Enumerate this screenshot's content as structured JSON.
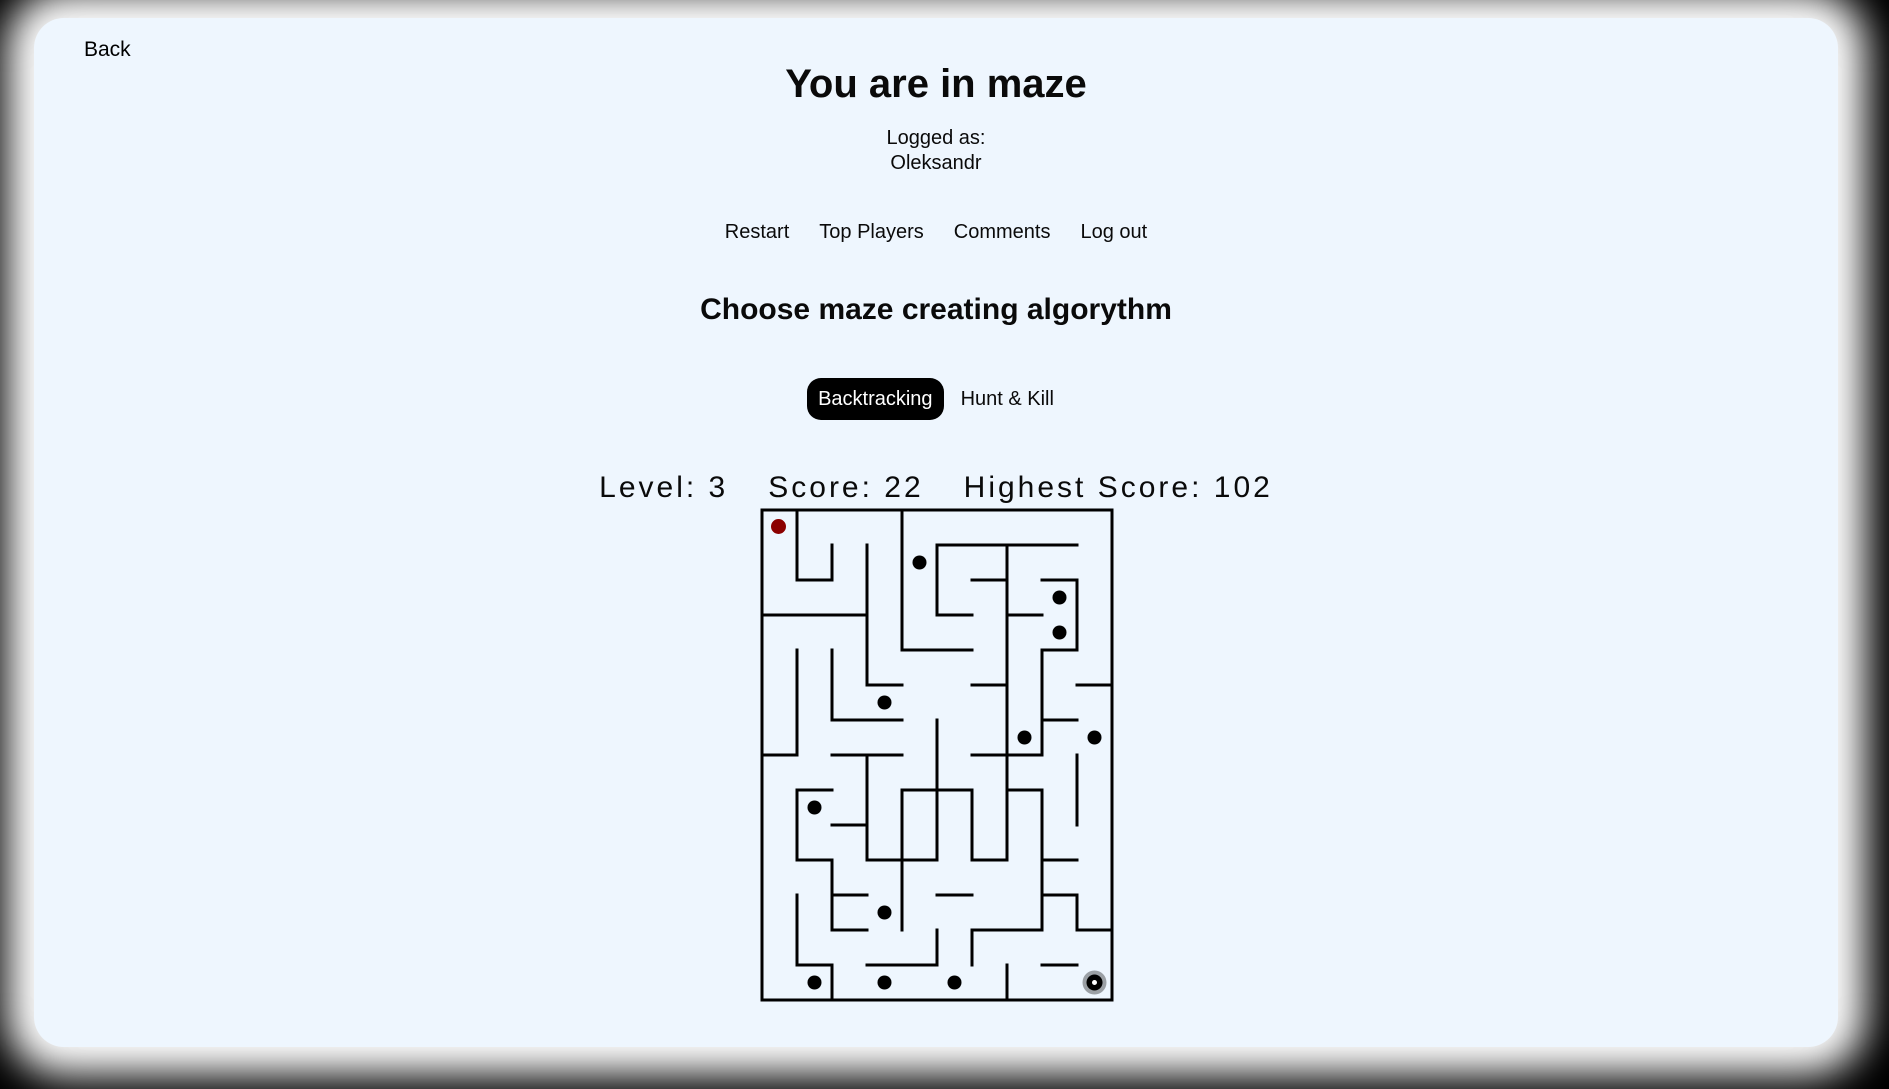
{
  "back_label": "Back",
  "title": "You are in maze",
  "logged_label": "Logged as:",
  "username": "Oleksandr",
  "nav": {
    "restart": "Restart",
    "top_players": "Top Players",
    "comments": "Comments",
    "logout": "Log out"
  },
  "algorithm_heading": "Choose maze creating algorythm",
  "algorithms": {
    "backtracking": "Backtracking",
    "hunt_kill": "Hunt & Kill",
    "selected": "Backtracking"
  },
  "stats": {
    "level": "Level: 3",
    "score": "Score: 22",
    "highest": "Highest Score: 102"
  },
  "maze": {
    "cols": 10,
    "rows": 14,
    "player_color": "#8b0000",
    "coin_color": "#000000",
    "player": [
      0,
      0
    ],
    "exit": [
      9,
      13
    ],
    "coins": [
      [
        4,
        1
      ],
      [
        8,
        2
      ],
      [
        8,
        3
      ],
      [
        3,
        5
      ],
      [
        7,
        6
      ],
      [
        9,
        6
      ],
      [
        1,
        8
      ],
      [
        3,
        11
      ],
      [
        1,
        13
      ],
      [
        3,
        13
      ],
      [
        5,
        13
      ]
    ],
    "walls": [
      [
        1,
        0,
        1,
        2
      ],
      [
        1,
        2,
        2,
        2
      ],
      [
        2,
        1,
        2,
        2
      ],
      [
        4,
        0,
        4,
        4
      ],
      [
        4,
        4,
        6,
        4
      ],
      [
        3,
        1,
        3,
        5
      ],
      [
        3,
        5,
        4,
        5
      ],
      [
        5,
        1,
        9,
        1
      ],
      [
        5,
        1,
        5,
        3
      ],
      [
        5,
        3,
        6,
        3
      ],
      [
        6,
        2,
        7,
        2
      ],
      [
        7,
        1,
        7,
        10
      ],
      [
        7,
        3,
        8,
        3
      ],
      [
        8,
        2,
        9,
        2
      ],
      [
        9,
        2,
        9,
        4
      ],
      [
        8,
        4,
        9,
        4
      ],
      [
        0,
        3,
        3,
        3
      ],
      [
        1,
        4,
        1,
        7
      ],
      [
        0,
        7,
        1,
        7
      ],
      [
        2,
        4,
        2,
        6
      ],
      [
        2,
        6,
        4,
        6
      ],
      [
        2,
        7,
        4,
        7
      ],
      [
        6,
        5,
        7,
        5
      ],
      [
        8,
        4,
        8,
        7
      ],
      [
        8,
        6,
        9,
        6
      ],
      [
        9,
        5,
        10,
        5
      ],
      [
        9,
        7,
        9,
        9
      ],
      [
        5,
        6,
        5,
        9
      ],
      [
        6,
        7,
        8,
        7
      ],
      [
        7,
        8,
        8,
        8
      ],
      [
        8,
        8,
        8,
        12
      ],
      [
        8,
        10,
        9,
        10
      ],
      [
        3,
        7,
        3,
        10
      ],
      [
        4,
        8,
        4,
        11
      ],
      [
        4,
        8,
        6,
        8
      ],
      [
        6,
        8,
        6,
        10
      ],
      [
        5,
        9,
        5,
        10
      ],
      [
        6,
        10,
        7,
        10
      ],
      [
        5,
        11,
        6,
        11
      ],
      [
        2,
        9,
        3,
        9
      ],
      [
        3,
        10,
        5,
        10
      ],
      [
        1,
        8,
        2,
        8
      ],
      [
        1,
        8,
        1,
        10
      ],
      [
        1,
        10,
        2,
        10
      ],
      [
        2,
        10,
        2,
        12
      ],
      [
        2,
        11,
        3,
        11
      ],
      [
        2,
        12,
        3,
        12
      ],
      [
        8,
        11,
        9,
        11
      ],
      [
        9,
        11,
        9,
        12
      ],
      [
        9,
        12,
        10,
        12
      ],
      [
        6,
        12,
        8,
        12
      ],
      [
        6,
        12,
        6,
        13
      ],
      [
        7,
        13,
        7,
        14
      ],
      [
        4,
        10,
        4,
        12
      ],
      [
        5,
        12,
        5,
        13
      ],
      [
        1,
        11,
        1,
        13
      ],
      [
        1,
        13,
        2,
        13
      ],
      [
        2,
        13,
        2,
        14
      ],
      [
        3,
        13,
        5,
        13
      ],
      [
        8,
        13,
        9,
        13
      ]
    ]
  }
}
